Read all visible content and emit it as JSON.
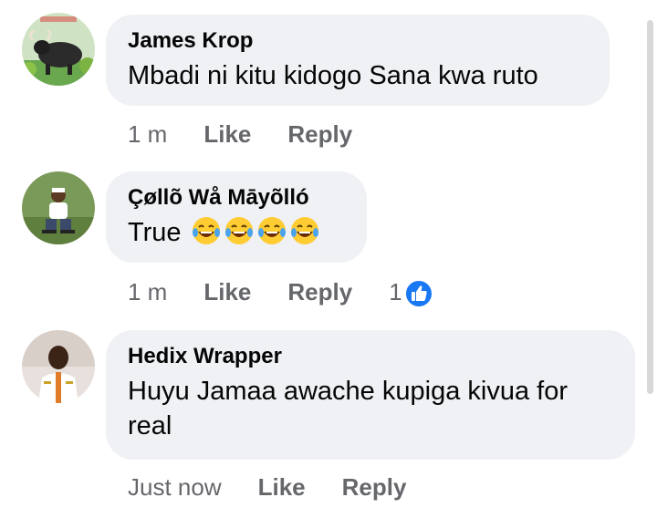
{
  "comments": [
    {
      "author": "James Krop",
      "text": "Mbadi ni kitu kidogo Sana kwa ruto",
      "time": "1 m",
      "like_label": "Like",
      "reply_label": "Reply"
    },
    {
      "author": "Çøllõ Wå Māyõlló",
      "text": "True",
      "emoji_count": 4,
      "time": "1 m",
      "like_label": "Like",
      "reply_label": "Reply",
      "reaction_count": "1",
      "reaction_icon": "thumbs-up-icon"
    },
    {
      "author": "Hedix Wrapper",
      "text": "Huyu Jamaa awache kupiga kivua for real",
      "time": "Just now",
      "like_label": "Like",
      "reply_label": "Reply"
    }
  ],
  "colors": {
    "bubble": "#eff1f4",
    "meta_text": "#65676b",
    "reaction_blue": "#1877f2"
  }
}
